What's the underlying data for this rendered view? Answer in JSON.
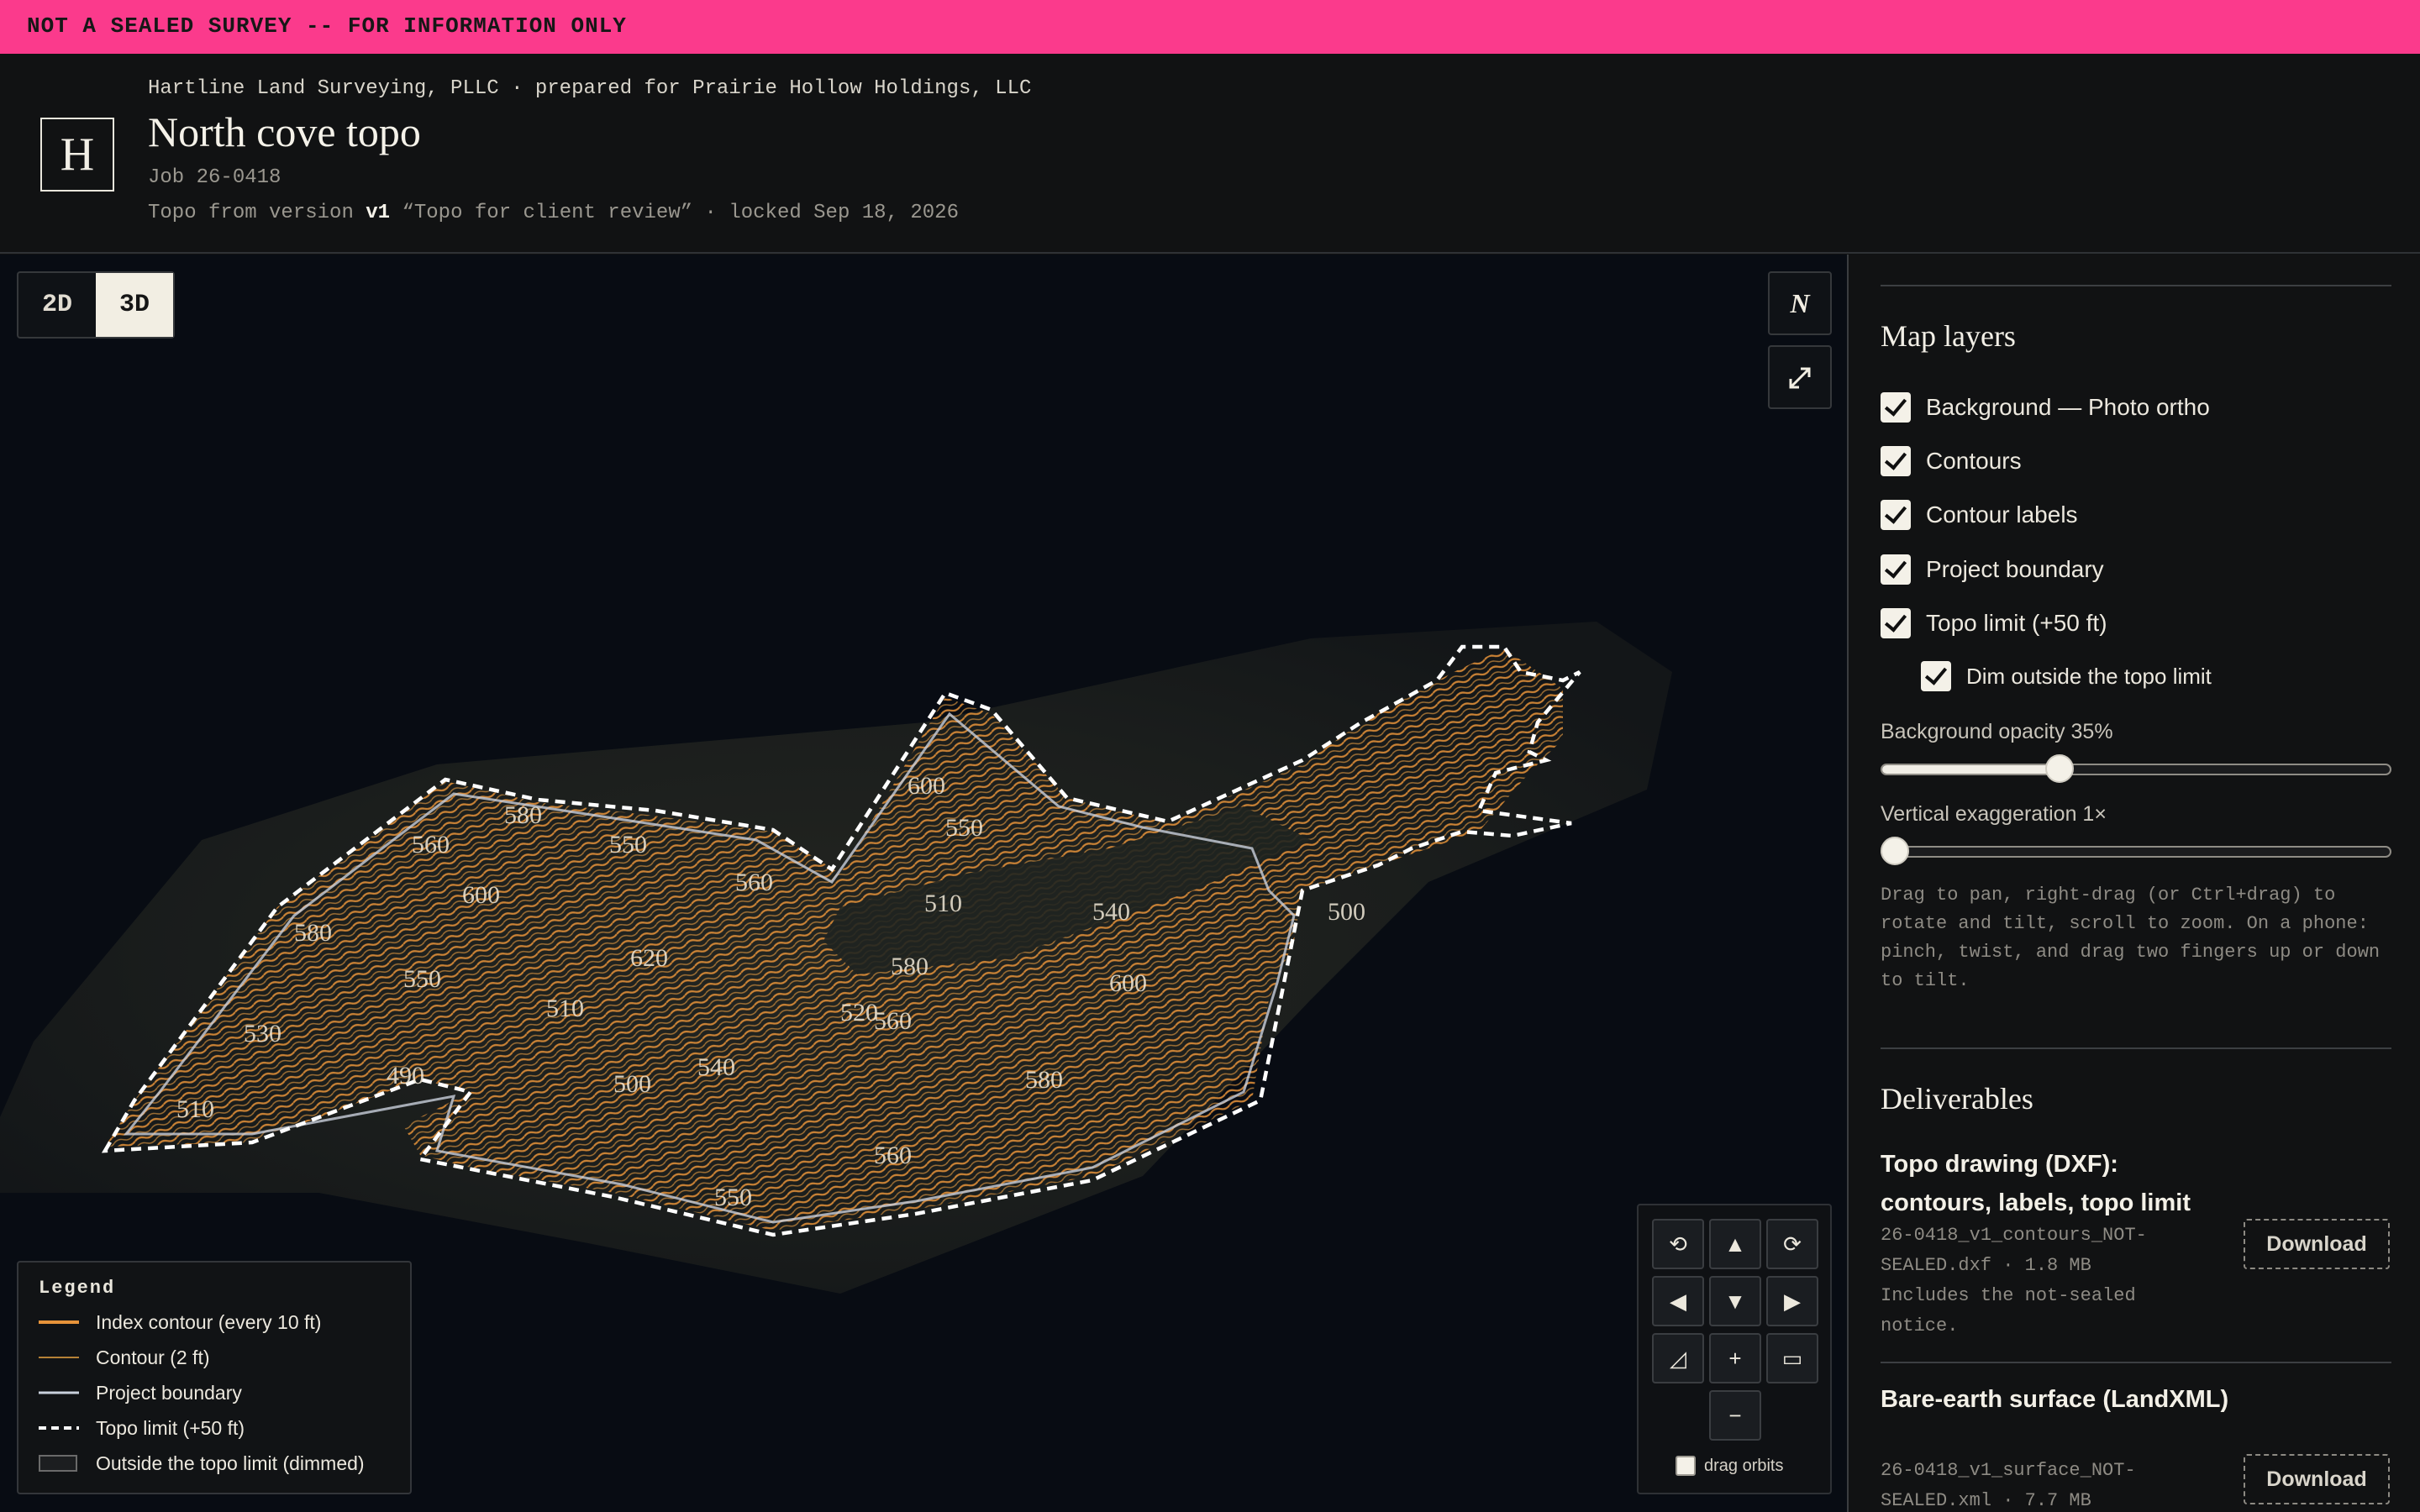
{
  "banner": {
    "text": "NOT A SEALED SURVEY -- FOR INFORMATION ONLY"
  },
  "header": {
    "logo_letter": "H",
    "firm_line": "Hartline Land Surveying, PLLC · prepared for Prairie Hollow Holdings, LLC",
    "title": "North cove topo",
    "job": "Job 26-0418",
    "version_prefix": "Topo from version",
    "version": "v1",
    "version_suffix": "“Topo for client review” · locked Sep 18, 2026"
  },
  "map": {
    "modes": [
      "2D",
      "3D"
    ],
    "active_mode": "3D",
    "north_icon": "N",
    "contour_labels": [
      "510",
      "530",
      "550",
      "580",
      "600",
      "540",
      "560",
      "490",
      "500",
      "510",
      "560",
      "580",
      "550",
      "600",
      "580",
      "560",
      "550",
      "620",
      "560",
      "550",
      "600",
      "510",
      "540",
      "520",
      "580",
      "500"
    ]
  },
  "legend": {
    "title": "Legend",
    "items": [
      {
        "label": "Index contour (every 10 ft)",
        "color": "#e8943a"
      },
      {
        "label": "Contour (2 ft)",
        "color": "#b58136"
      },
      {
        "label": "Project boundary",
        "color": "#c9d0dc"
      },
      {
        "label": "Topo limit (+50 ft)",
        "color": "#ffffff"
      },
      {
        "label": "Outside the topo limit (dimmed)",
        "color": "#6a6a6a"
      }
    ]
  },
  "navpad": {
    "buttons": [
      "⟲",
      "▲",
      "⟳",
      "◀",
      "▼",
      "▶",
      "◿",
      "+",
      "▭",
      "−"
    ],
    "drag_orbits_label": "drag orbits",
    "drag_orbits_checked": false
  },
  "panel": {
    "layers_title": "Map layers",
    "layers": [
      {
        "label": "Background — Photo ortho",
        "checked": true
      },
      {
        "label": "Contours",
        "checked": true
      },
      {
        "label": "Contour labels",
        "checked": true
      },
      {
        "label": "Project boundary",
        "checked": true
      },
      {
        "label": "Topo limit (+50 ft)",
        "checked": true
      }
    ],
    "sublayer": {
      "label": "Dim outside the topo limit",
      "checked": true
    },
    "bg_opacity_label": "Background opacity 35%",
    "bg_opacity": 0.35,
    "vert_exag_label": "Vertical exaggeration 1×",
    "vert_exag": 0,
    "help": "Drag to pan, right-drag (or Ctrl+drag) to rotate and tilt, scroll to zoom. On a phone: pinch, twist, and drag two fingers up or down to tilt.",
    "deliverables_title": "Deliverables",
    "deliverables": [
      {
        "title": "Topo drawing (DXF): contours, labels, topo limit",
        "meta": "26-0418_v1_contours_NOT-SEALED.dxf · 1.8 MB",
        "note": "Includes the not-sealed notice.",
        "button": "Download"
      },
      {
        "title": "Bare-earth surface (LandXML)",
        "meta": "26-0418_v1_surface_NOT-SEALED.xml · 7.7 MB",
        "note": "",
        "button": "Download"
      }
    ]
  },
  "colors": {
    "banner": "#fb3a8c",
    "contour": "#e8943a",
    "map_bg": "#080c13",
    "panel_bg": "#111213"
  }
}
